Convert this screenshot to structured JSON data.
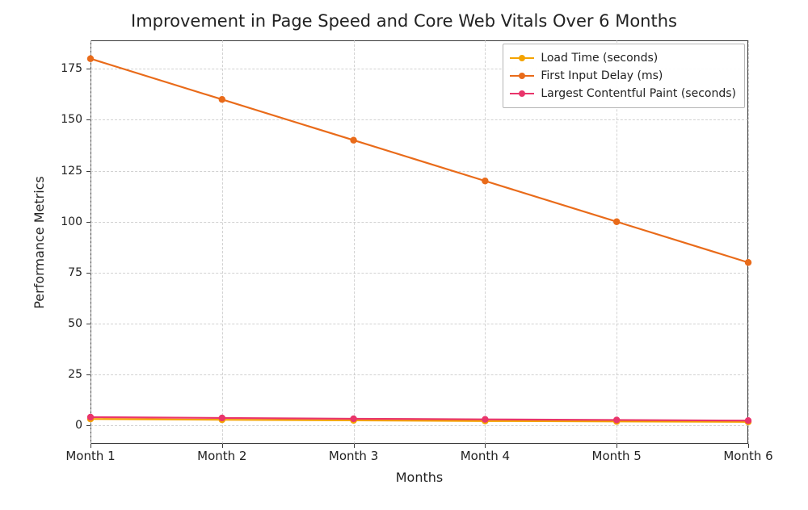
{
  "chart_data": {
    "type": "line",
    "title": "Improvement in Page Speed and Core Web Vitals Over 6 Months",
    "xlabel": "Months",
    "ylabel": "Performance Metrics",
    "categories": [
      "Month 1",
      "Month 2",
      "Month 3",
      "Month 4",
      "Month 5",
      "Month 6"
    ],
    "series": [
      {
        "name": "Load Time (seconds)",
        "color": "#f4a300",
        "values": [
          3.2,
          2.8,
          2.5,
          2.2,
          2.0,
          1.8
        ]
      },
      {
        "name": "First Input Delay (ms)",
        "color": "#e96b1a",
        "values": [
          180,
          160,
          140,
          120,
          100,
          80
        ]
      },
      {
        "name": "Largest Contentful Paint (seconds)",
        "color": "#e9356b",
        "values": [
          4.1,
          3.7,
          3.3,
          3.0,
          2.7,
          2.4
        ]
      }
    ],
    "yticks": [
      0,
      25,
      50,
      75,
      100,
      125,
      150,
      175
    ],
    "ylim": [
      -9,
      189
    ],
    "legend_position": "upper right",
    "grid": true
  }
}
